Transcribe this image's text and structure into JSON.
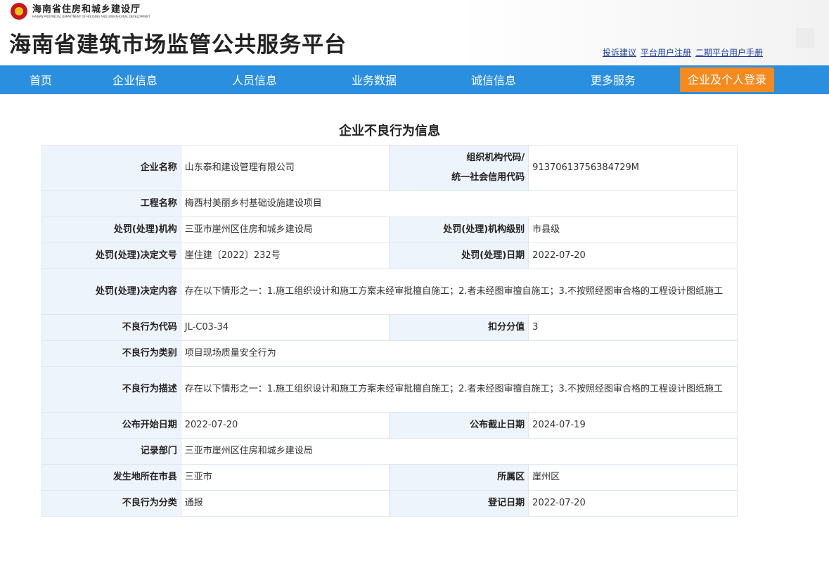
{
  "header": {
    "dept_cn": "海南省住房和城乡建设厅",
    "dept_en": "HAINAN PROVINCIAL DEPARTMENT OF HOUSING AND URBAN-RURAL DEVELOPMENT",
    "site_title": "海南省建筑市场监管公共服务平台",
    "links": [
      "投诉建议",
      "平台用户注册",
      "二期平台用户手册"
    ]
  },
  "nav": {
    "items": [
      "首页",
      "企业信息",
      "人员信息",
      "业务数据",
      "诚信信息",
      "更多服务"
    ],
    "login": "企业及个人登录"
  },
  "page_title": "企业不良行为信息",
  "rows": {
    "company_label": "企业名称",
    "company": "山东泰和建设管理有限公司",
    "org_code_label_1": "组织机构代码/",
    "org_code_label_2": "统一社会信用代码",
    "org_code": "91370613756384729M",
    "project_label": "工程名称",
    "project": "梅西村美丽乡村基础设施建设项目",
    "agency_label": "处罚(处理)机构",
    "agency": "三亚市崖州区住房和城乡建设局",
    "agency_level_label": "处罚(处理)机构级别",
    "agency_level": "市县级",
    "doc_no_label": "处罚(处理)决定文号",
    "doc_no": "崖住建〔2022〕232号",
    "decision_date_label": "处罚(处理)日期",
    "decision_date": "2022-07-20",
    "content_label": "处罚(处理)决定内容",
    "content": "存在以下情形之一：1.施工组织设计和施工方案未经审批擅自施工；2.者未经图审擅自施工；3.不按照经图审合格的工程设计图纸施工",
    "code_label": "不良行为代码",
    "code": "JL-C03-34",
    "score_label": "扣分分值",
    "score": "3",
    "category_label": "不良行为类别",
    "category": "项目现场质量安全行为",
    "desc_label": "不良行为描述",
    "desc": "存在以下情形之一：1.施工组织设计和施工方案未经审批擅自施工；2.者未经图审擅自施工；3.不按照经图审合格的工程设计图纸施工",
    "pub_start_label": "公布开始日期",
    "pub_start": "2022-07-20",
    "pub_end_label": "公布截止日期",
    "pub_end": "2024-07-19",
    "record_dept_label": "记录部门",
    "record_dept": "三亚市崖州区住房和城乡建设局",
    "city_label": "发生地所在市县",
    "city": "三亚市",
    "district_label": "所属区",
    "district": "崖州区",
    "class_label": "不良行为分类",
    "class": "通报",
    "reg_date_label": "登记日期",
    "reg_date": "2022-07-20"
  }
}
